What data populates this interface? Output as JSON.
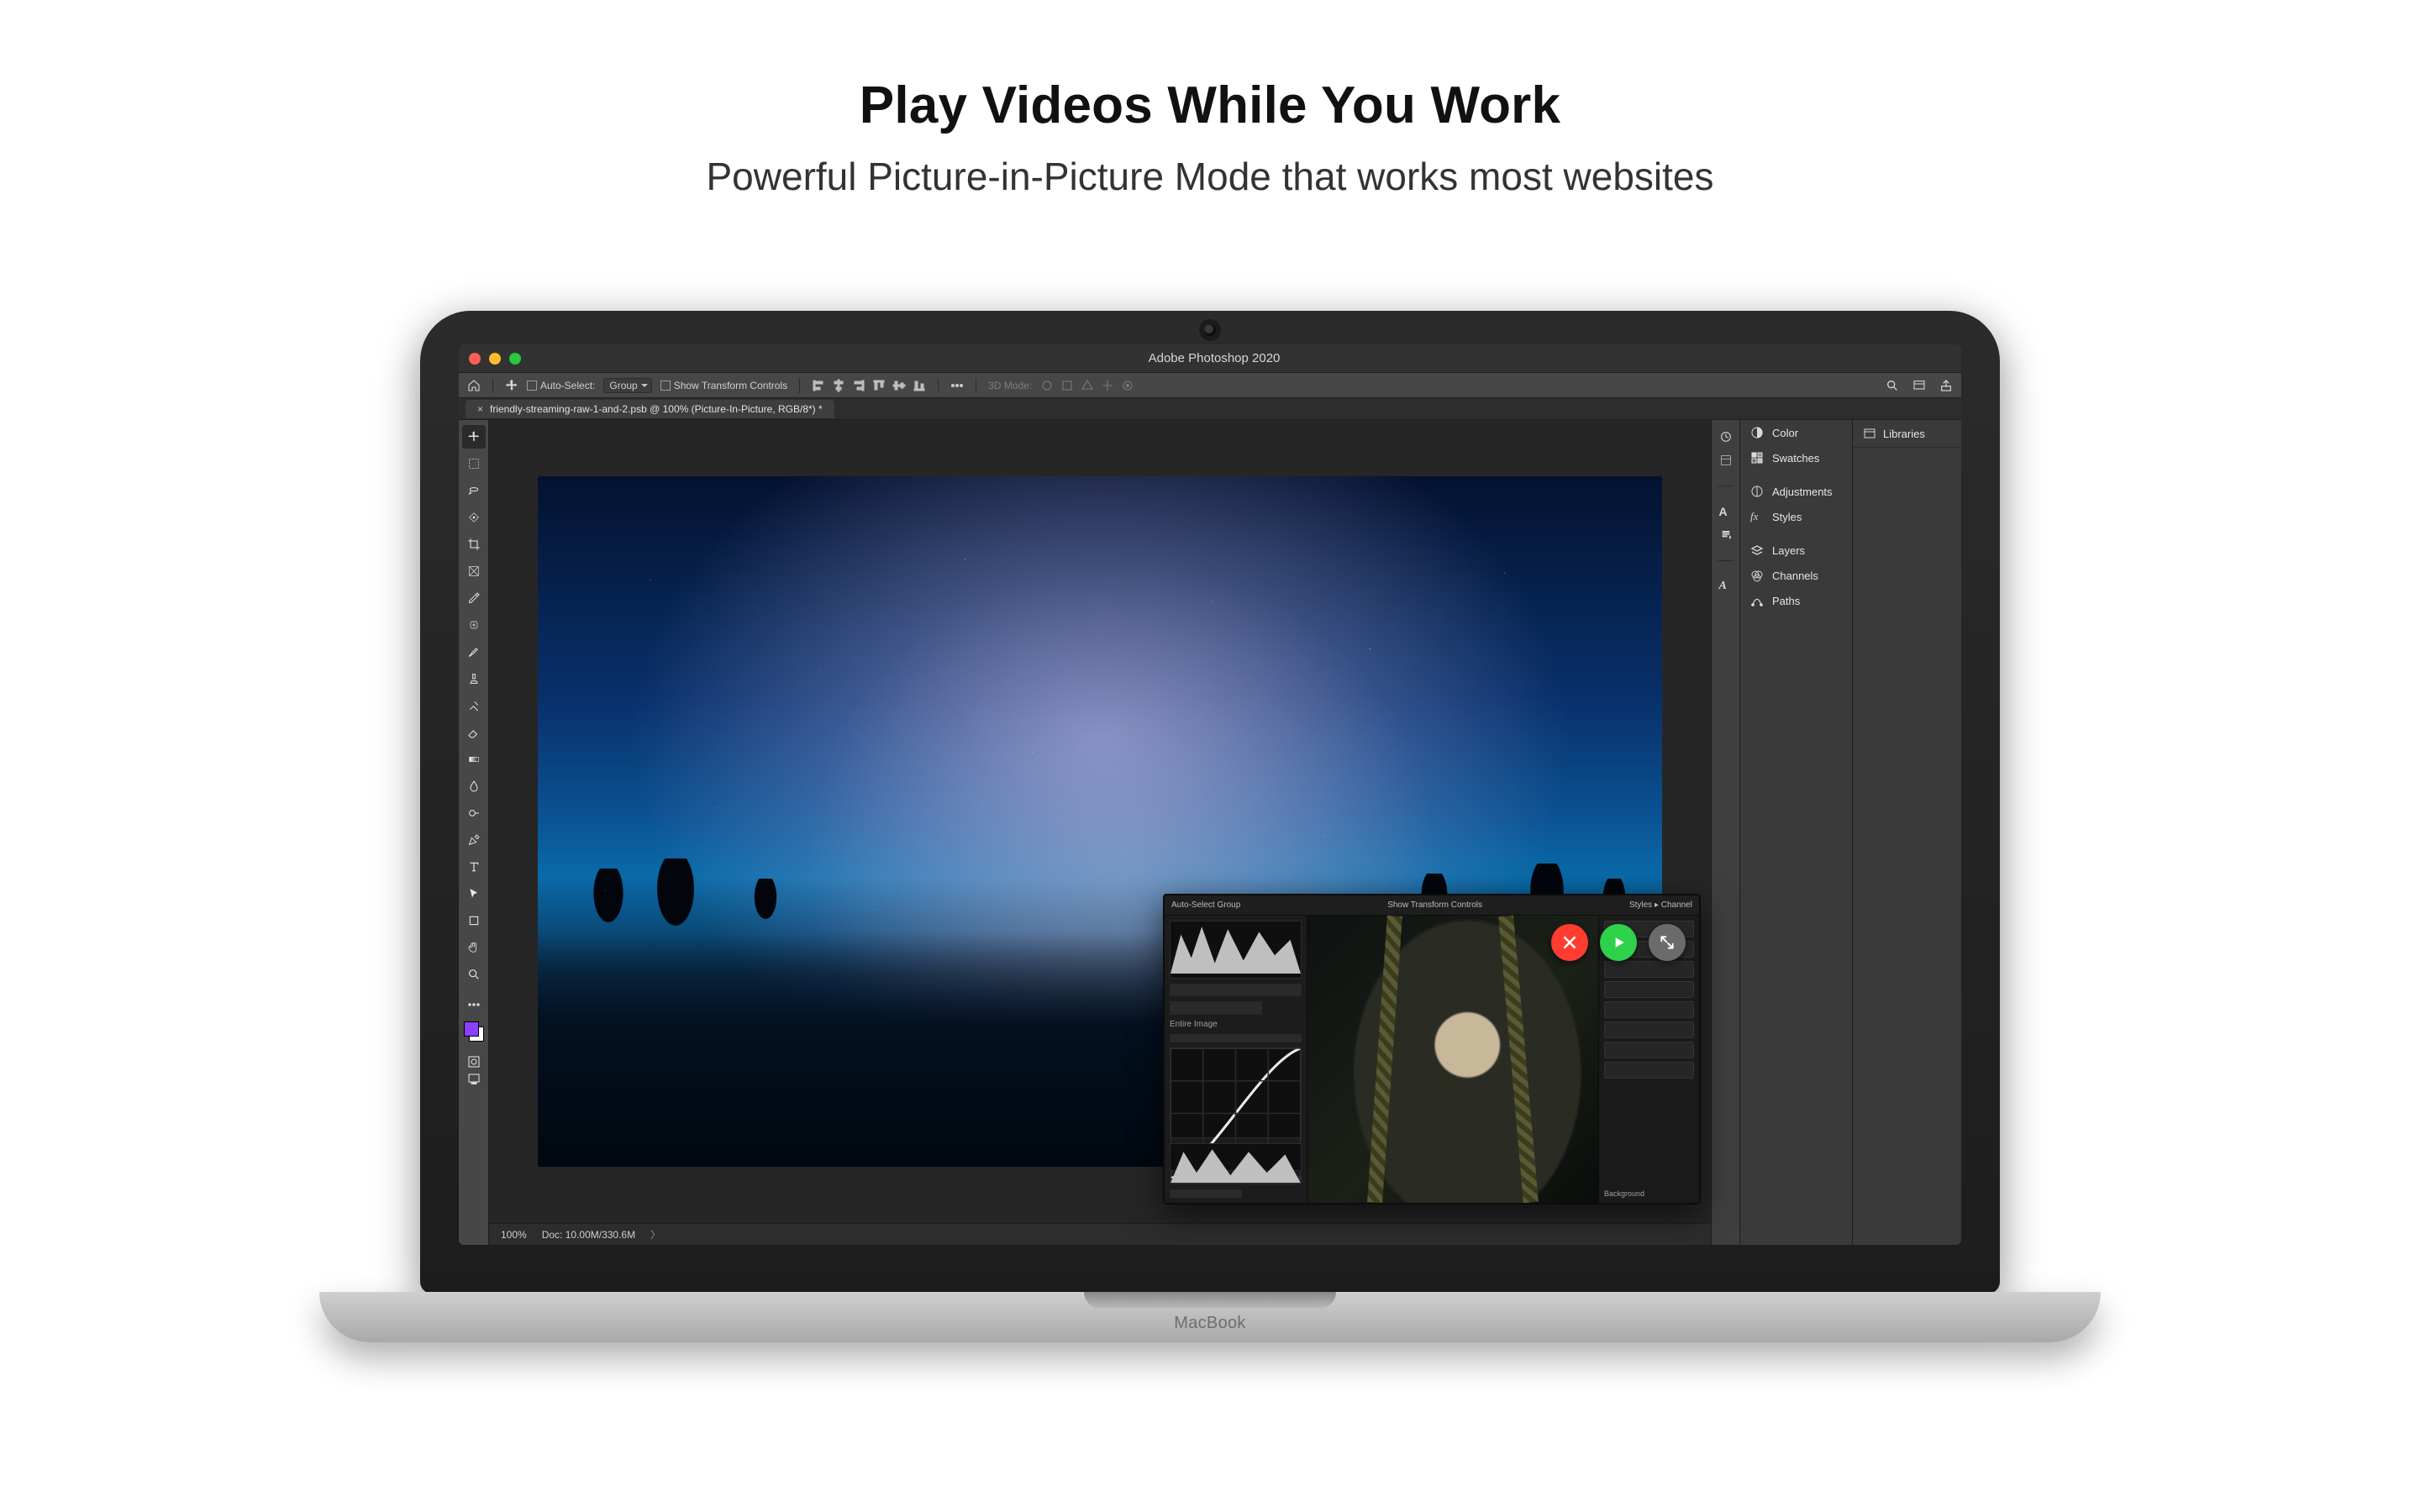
{
  "marketing": {
    "headline": "Play Videos While You Work",
    "subheadline": "Powerful Picture-in-Picture Mode that works most websites"
  },
  "device": {
    "brand": "MacBook"
  },
  "photoshop": {
    "window_title": "Adobe Photoshop 2020",
    "options_bar": {
      "auto_select_label": "Auto-Select:",
      "auto_select_target": "Group",
      "show_transform_label": "Show Transform Controls",
      "mode_3d_label": "3D Mode:"
    },
    "document_tab": "friendly-streaming-raw-1-and-2.psb @ 100% (Picture-In-Picture, RGB/8*) *",
    "status": {
      "zoom": "100%",
      "doc_info": "Doc: 10.00M/330.6M"
    },
    "panels1": [
      "Color",
      "Swatches",
      "Adjustments",
      "Styles",
      "Layers",
      "Channels",
      "Paths"
    ],
    "panels2": [
      "Libraries"
    ],
    "foreground_color": "#8b3fff",
    "background_color": "#ffffff"
  },
  "pip": {
    "opt_left": "Auto-Select   Group",
    "opt_center": "Show Transform Controls",
    "opt_right": "Styles  ▸  Channel",
    "panel_labels": [
      "Entire Image",
      "Background"
    ],
    "controls": [
      "close",
      "play",
      "expand"
    ]
  }
}
